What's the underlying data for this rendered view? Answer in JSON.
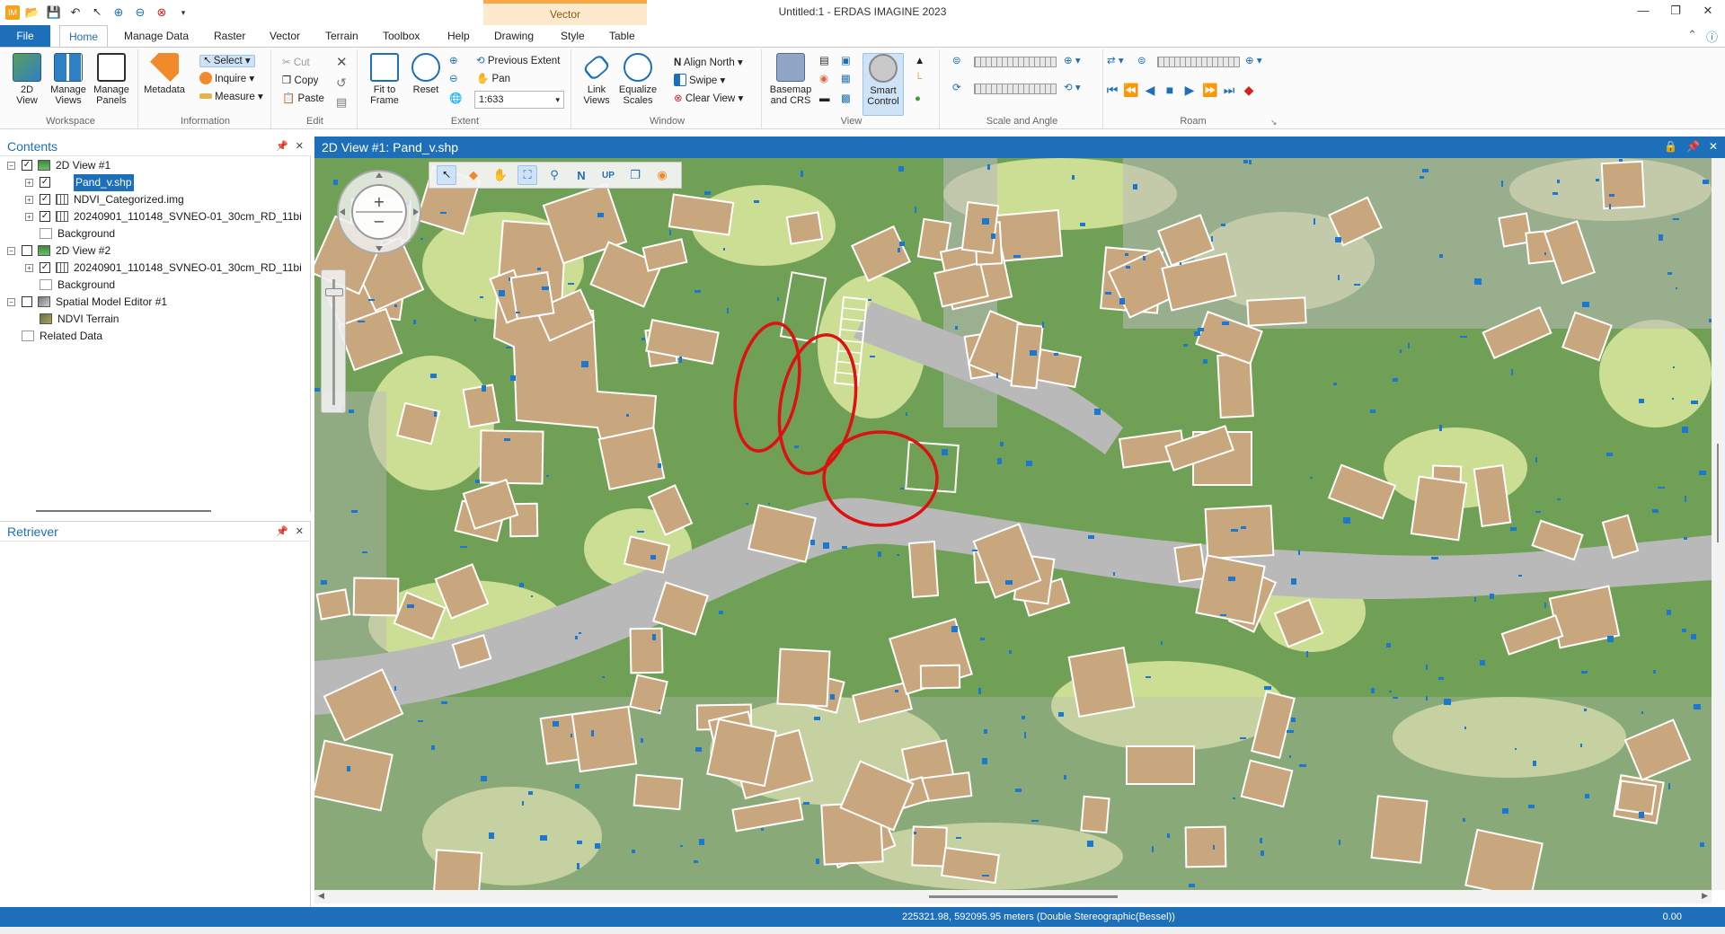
{
  "titlebar": {
    "title": "Untitled:1 - ERDAS IMAGINE 2023",
    "context_group": "Vector",
    "icons": [
      "app-icon",
      "open-icon",
      "save-icon",
      "undo-icon",
      "select-arrow-icon",
      "zoom-in-icon",
      "zoom-out-icon",
      "clear-icon",
      "customize-icon"
    ]
  },
  "tabs": [
    "File",
    "Home",
    "Manage Data",
    "Raster",
    "Vector",
    "Terrain",
    "Toolbox",
    "Help",
    "Drawing",
    "Style",
    "Table"
  ],
  "active_tab": "Home",
  "ribbon": {
    "workspace": {
      "label": "Workspace",
      "view2d": "2D\nView",
      "manage_views": "Manage\nViews",
      "manage_panels": "Manage\nPanels"
    },
    "information": {
      "label": "Information",
      "metadata": "Metadata",
      "select": "Select",
      "inquire": "Inquire",
      "measure": "Measure"
    },
    "edit": {
      "label": "Edit",
      "cut": "Cut",
      "copy": "Copy",
      "paste": "Paste"
    },
    "extent": {
      "label": "Extent",
      "fit_to_frame": "Fit to\nFrame",
      "reset": "Reset",
      "previous_extent": "Previous Extent",
      "pan": "Pan",
      "scale": "1:633"
    },
    "window": {
      "label": "Window",
      "link_views": "Link\nViews",
      "equalize_scales": "Equalize\nScales",
      "align_north": "Align North",
      "swipe": "Swipe",
      "clear_view": "Clear View"
    },
    "view": {
      "label": "View",
      "basemap": "Basemap\nand CRS",
      "smart_control": "Smart\nControl"
    },
    "scale_angle": {
      "label": "Scale and Angle"
    },
    "roam": {
      "label": "Roam"
    }
  },
  "contents": {
    "title": "Contents",
    "tree": [
      {
        "label": "2D View #1",
        "level": 0,
        "checked": true,
        "expand": "minus",
        "icon": "view"
      },
      {
        "label": "Pand_v.shp",
        "level": 1,
        "checked": true,
        "expand": "plus",
        "icon": "none",
        "selected": true
      },
      {
        "label": "NDVI_Categorized.img",
        "level": 1,
        "checked": true,
        "expand": "plus",
        "icon": "raster"
      },
      {
        "label": "20240901_110148_SVNEO-01_30cm_RD_11bi",
        "level": 1,
        "checked": true,
        "expand": "plus",
        "icon": "raster"
      },
      {
        "label": "Background",
        "level": 1,
        "checked": null,
        "expand": "none",
        "icon": "bg"
      },
      {
        "label": "2D View #2",
        "level": 0,
        "checked": false,
        "expand": "minus",
        "icon": "view"
      },
      {
        "label": "20240901_110148_SVNEO-01_30cm_RD_11bi",
        "level": 1,
        "checked": true,
        "expand": "plus",
        "icon": "raster"
      },
      {
        "label": "Background",
        "level": 1,
        "checked": null,
        "expand": "none",
        "icon": "bg"
      },
      {
        "label": "Spatial Model Editor #1",
        "level": 0,
        "checked": false,
        "expand": "minus",
        "icon": "model"
      },
      {
        "label": "NDVI Terrain",
        "level": 1,
        "checked": null,
        "expand": "none",
        "icon": "terrain"
      },
      {
        "label": "Related Data",
        "level": 0,
        "checked": null,
        "expand": "none",
        "icon": "bg"
      }
    ]
  },
  "retriever": {
    "title": "Retriever"
  },
  "view": {
    "title": "2D View #1: Pand_v.shp",
    "colors": {
      "vegetation": "#6fa055",
      "light_vegetation": "#d6e39b",
      "built": "#b9b9b9",
      "roof": "#c8a67e",
      "water": "#1a78d2",
      "outline": "#ffffff",
      "highlight": "#dd1111"
    },
    "map_tools": [
      "select-pointer-icon",
      "tag-icon",
      "pan-hand-icon",
      "fit-icon",
      "zoom-icon",
      "north-icon",
      "up-icon",
      "layers-icon",
      "info-icon"
    ],
    "map_tool_labels": {
      "north": "N",
      "up": "UP"
    }
  },
  "status": {
    "coords": "225321.98, 592095.95 meters (Double Stereographic(Bessel))",
    "rotation": "0.00"
  }
}
